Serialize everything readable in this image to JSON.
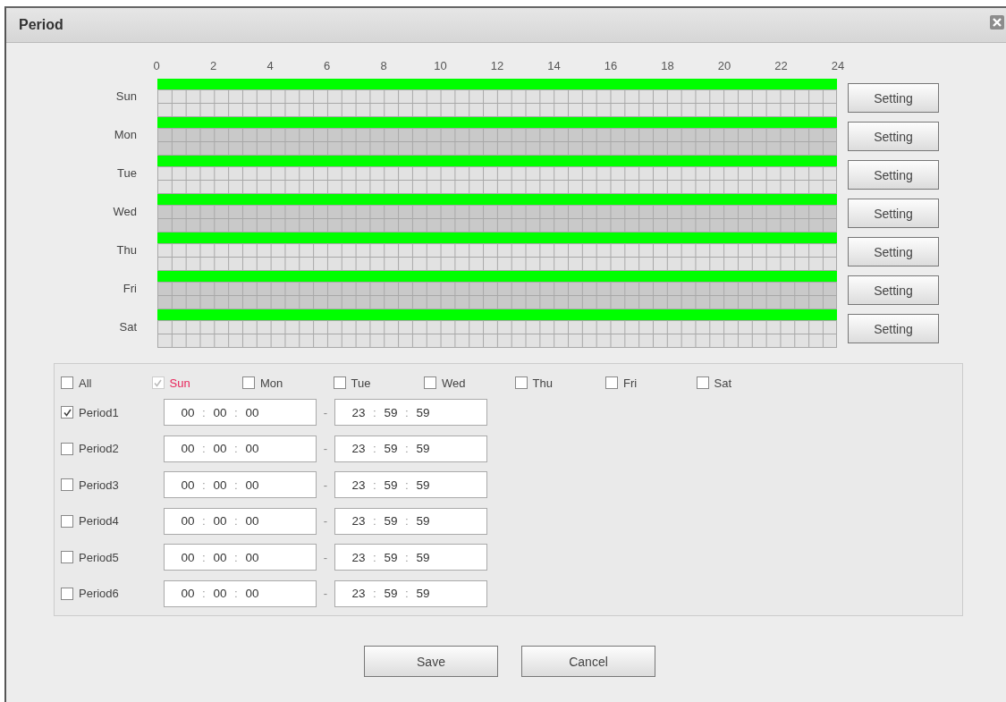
{
  "window": {
    "title": "Period"
  },
  "hours": [
    "0",
    "2",
    "4",
    "6",
    "8",
    "10",
    "12",
    "14",
    "16",
    "18",
    "20",
    "22",
    "24"
  ],
  "days": [
    {
      "label": "Sun",
      "level": 1,
      "button": "Setting"
    },
    {
      "label": "Mon",
      "level": 1,
      "button": "Setting"
    },
    {
      "label": "Tue",
      "level": 1,
      "button": "Setting"
    },
    {
      "label": "Wed",
      "level": 1,
      "button": "Setting"
    },
    {
      "label": "Thu",
      "level": 1,
      "button": "Setting"
    },
    {
      "label": "Fri",
      "level": 1,
      "button": "Setting"
    },
    {
      "label": "Sat",
      "level": 1,
      "button": "Setting"
    }
  ],
  "day_checks": [
    {
      "label": "All",
      "checked": false,
      "disabled": false,
      "current": false
    },
    {
      "label": "Sun",
      "checked": true,
      "disabled": true,
      "current": true
    },
    {
      "label": "Mon",
      "checked": false,
      "disabled": false,
      "current": false
    },
    {
      "label": "Tue",
      "checked": false,
      "disabled": false,
      "current": false
    },
    {
      "label": "Wed",
      "checked": false,
      "disabled": false,
      "current": false
    },
    {
      "label": "Thu",
      "checked": false,
      "disabled": false,
      "current": false
    },
    {
      "label": "Fri",
      "checked": false,
      "disabled": false,
      "current": false
    },
    {
      "label": "Sat",
      "checked": false,
      "disabled": false,
      "current": false
    }
  ],
  "periods": [
    {
      "label": "Period1",
      "checked": true,
      "start": [
        "00",
        ":",
        "00",
        ":",
        "00"
      ],
      "separator": "-",
      "end": [
        "23",
        ":",
        "59",
        ":",
        "59"
      ]
    },
    {
      "label": "Period2",
      "checked": false,
      "start": [
        "00",
        ":",
        "00",
        ":",
        "00"
      ],
      "separator": "-",
      "end": [
        "23",
        ":",
        "59",
        ":",
        "59"
      ]
    },
    {
      "label": "Period3",
      "checked": false,
      "start": [
        "00",
        ":",
        "00",
        ":",
        "00"
      ],
      "separator": "-",
      "end": [
        "23",
        ":",
        "59",
        ":",
        "59"
      ]
    },
    {
      "label": "Period4",
      "checked": false,
      "start": [
        "00",
        ":",
        "00",
        ":",
        "00"
      ],
      "separator": "-",
      "end": [
        "23",
        ":",
        "59",
        ":",
        "59"
      ]
    },
    {
      "label": "Period5",
      "checked": false,
      "start": [
        "00",
        ":",
        "00",
        ":",
        "00"
      ],
      "separator": "-",
      "end": [
        "23",
        ":",
        "59",
        ":",
        "59"
      ]
    },
    {
      "label": "Period6",
      "checked": false,
      "start": [
        "00",
        ":",
        "00",
        ":",
        "00"
      ],
      "separator": "-",
      "end": [
        "23",
        ":",
        "59",
        ":",
        "59"
      ]
    }
  ],
  "buttons": [
    "Save",
    "Cancel"
  ]
}
